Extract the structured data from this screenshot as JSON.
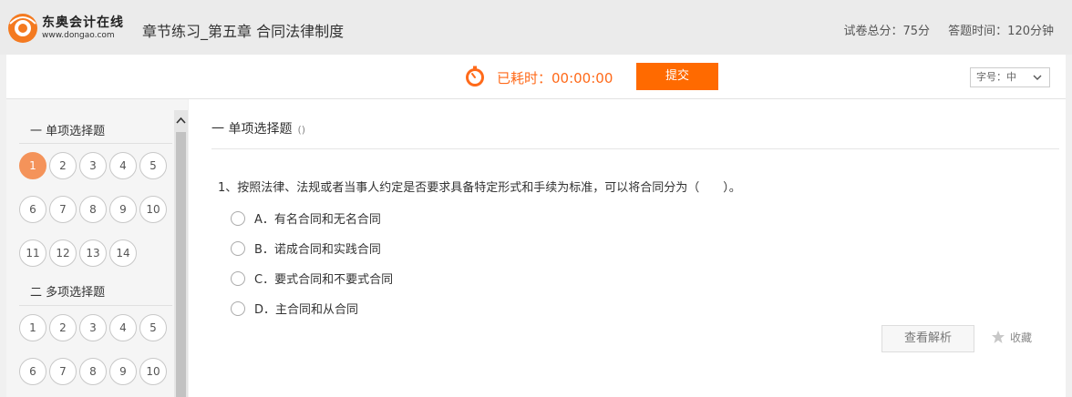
{
  "header": {
    "logo_text": "东奥会计在线",
    "logo_url": "www.dongao.com",
    "title": "章节练习_第五章 合同法律制度",
    "total_score": "试卷总分：75分",
    "answer_time": "答题时间：120分钟"
  },
  "toolbar": {
    "elapsed_label": "已耗时：00:00:00",
    "submit_label": "提交",
    "font_size_label": "字号：中"
  },
  "sidebar": {
    "sections": [
      {
        "title": "一 单项选择题",
        "numbers": [
          "1",
          "2",
          "3",
          "4",
          "5",
          "6",
          "7",
          "8",
          "9",
          "10",
          "11",
          "12",
          "13",
          "14"
        ]
      },
      {
        "title": "二 多项选择题",
        "numbers": [
          "1",
          "2",
          "3",
          "4",
          "5",
          "6",
          "7",
          "8",
          "9",
          "10"
        ]
      }
    ]
  },
  "main": {
    "section_title": "一 单项选择题",
    "section_note": "()",
    "question": "1、按照法律、法规或者当事人约定是否要求具备特定形式和手续为标准，可以将合同分为（　　）。",
    "options": [
      "A．有名合同和无名合同",
      "B．诺成合同和实践合同",
      "C．要式合同和不要式合同",
      "D．主合同和从合同"
    ],
    "analysis_label": "查看解析",
    "favorite_label": "收藏"
  },
  "colors": {
    "accent": "#ff6a00",
    "active_num": "#f4935a"
  }
}
